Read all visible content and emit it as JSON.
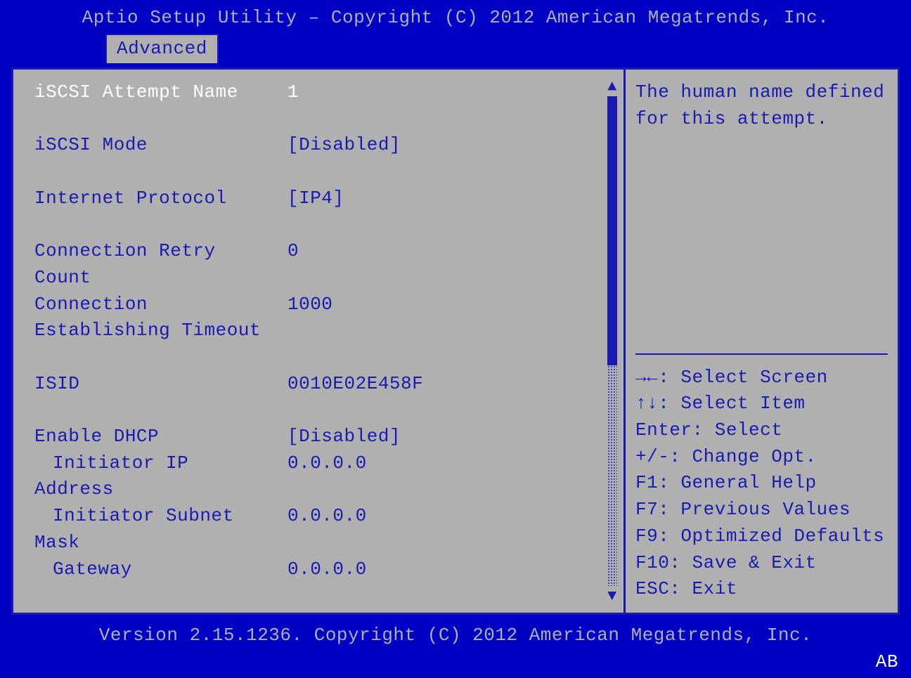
{
  "title": "Aptio Setup Utility – Copyright (C) 2012 American Megatrends, Inc.",
  "tabs": [
    {
      "label": "Advanced",
      "active": true
    }
  ],
  "settings": {
    "rows": [
      {
        "label": "iSCSI Attempt Name",
        "value": "1",
        "selected": true
      },
      null,
      {
        "label": "iSCSI Mode",
        "value": "[Disabled]"
      },
      null,
      {
        "label": "Internet Protocol",
        "value": "[IP4]"
      },
      null,
      {
        "label": "Connection Retry",
        "value": "0"
      },
      {
        "label": "Count",
        "continuation": true
      },
      {
        "label": "Connection",
        "value": "1000"
      },
      {
        "label": "Establishing Timeout",
        "continuation": true
      },
      null,
      {
        "label": "ISID",
        "value": "0010E02E458F"
      },
      null,
      {
        "label": "Enable DHCP",
        "value": "[Disabled]"
      },
      {
        "label": "Initiator IP",
        "value": "0.0.0.0",
        "indent": true
      },
      {
        "label": "Address",
        "continuation": true
      },
      {
        "label": "Initiator Subnet",
        "value": "0.0.0.0",
        "indent": true
      },
      {
        "label": "Mask",
        "continuation": true
      },
      {
        "label": "Gateway",
        "value": "0.0.0.0",
        "indent": true
      }
    ]
  },
  "help": {
    "description": "The human name defined for this attempt.",
    "keys": [
      "→←: Select Screen",
      "↑↓: Select Item",
      "Enter: Select",
      "+/-: Change Opt.",
      "F1: General Help",
      "F7: Previous Values",
      "F9: Optimized Defaults",
      "F10: Save & Exit",
      "ESC: Exit"
    ]
  },
  "footer": "Version 2.15.1236. Copyright (C) 2012 American Megatrends, Inc.",
  "corner_mark": "AB"
}
